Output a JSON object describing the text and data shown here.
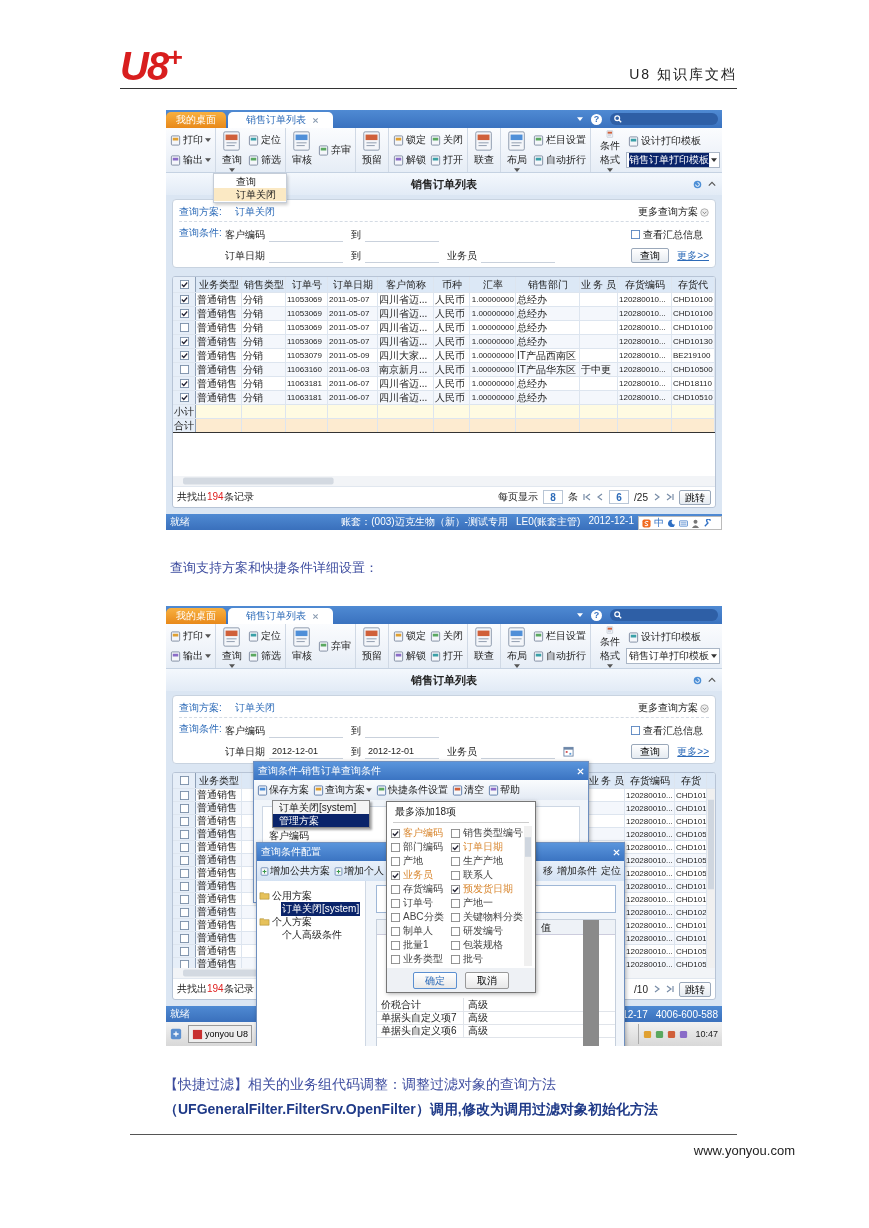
{
  "header": {
    "logo": "U8$^{+}$",
    "doc_title": "U8 知识库文档"
  },
  "screenshots": [
    {
      "tabs": [
        {
          "label": "我的桌面",
          "selected": false,
          "closable": false
        },
        {
          "label": "销售订单列表",
          "selected": true,
          "closable": true
        }
      ],
      "help": "?",
      "toolbar": [
        {
          "columns": [
            {
              "kind": "pair",
              "items": [
                {
                  "kind": "button",
                  "label": "打印",
                  "menu": true
                },
                {
                  "kind": "button",
                  "label": "输出",
                  "menu": true
                }
              ]
            }
          ]
        },
        {
          "columns": [
            {
              "kind": "big",
              "label": "查询",
              "menu": true
            },
            {
              "kind": "pair",
              "items": [
                {
                  "kind": "button",
                  "label": "定位",
                  "menu": false
                },
                {
                  "kind": "button",
                  "label": "筛选",
                  "menu": false
                }
              ]
            }
          ]
        },
        {
          "columns": [
            {
              "kind": "big",
              "label": "审核",
              "menu": false
            },
            {
              "kind": "pair",
              "items": [
                {
                  "kind": "button",
                  "label": "弃审",
                  "menu": false
                }
              ]
            }
          ]
        },
        {
          "columns": [
            {
              "kind": "big",
              "label": "预留",
              "menu": false
            }
          ]
        },
        {
          "columns": [
            {
              "kind": "pair",
              "items": [
                {
                  "kind": "button",
                  "label": "锁定",
                  "menu": false
                },
                {
                  "kind": "button",
                  "label": "解锁",
                  "menu": false
                }
              ]
            },
            {
              "kind": "pair",
              "items": [
                {
                  "kind": "button",
                  "label": "关闭",
                  "menu": false
                },
                {
                  "kind": "button",
                  "label": "打开",
                  "menu": false
                }
              ]
            }
          ]
        },
        {
          "columns": [
            {
              "kind": "big",
              "label": "联查",
              "menu": false
            }
          ]
        },
        {
          "columns": [
            {
              "kind": "big",
              "label": "布局",
              "menu": true
            },
            {
              "kind": "pair",
              "items": [
                {
                  "kind": "button",
                  "label": "栏目设置",
                  "menu": false
                },
                {
                  "kind": "button",
                  "label": "自动折行",
                  "menu": false
                }
              ]
            }
          ]
        },
        {
          "columns": [
            {
              "kind": "big",
              "label": "条件格式",
              "menu": true
            },
            {
              "kind": "pair",
              "items": [
                {
                  "kind": "button",
                  "label": "设计打印模板",
                  "menu": false
                },
                {
                  "kind": "select",
                  "value": "销售订单打印模板",
                  "text_selected": true
                }
              ]
            }
          ]
        }
      ],
      "menu": {
        "items": [
          {
            "label": "查询",
            "selected": false
          },
          {
            "label": "订单关闭",
            "selected": true
          }
        ]
      },
      "title": "销售订单列表",
      "query": {
        "scheme_label": "查询方案:",
        "scheme": "订单关闭",
        "more_schemes": "更多查询方案",
        "condition_label": "查询条件:",
        "rows": [
          [
            {
              "label": "客户编码"
            },
            {
              "label": "到"
            }
          ],
          [
            {
              "label": "订单日期"
            },
            {
              "label": "到"
            },
            {
              "label": "业务员"
            }
          ]
        ],
        "date_picker": false,
        "summary": {
          "label": "查看汇总信息",
          "checked": false
        },
        "button": "查询",
        "more": "更多>>"
      },
      "grid": {
        "header_checked": true,
        "columns": [
          {
            "label": "业务类型",
            "kind": "text"
          },
          {
            "label": "销售类型",
            "kind": "text"
          },
          {
            "label": "订单号",
            "kind": "code"
          },
          {
            "label": "订单日期",
            "kind": "code"
          },
          {
            "label": "客户简称",
            "kind": "text"
          },
          {
            "label": "币种",
            "kind": "text"
          },
          {
            "label": "汇率",
            "kind": "number"
          },
          {
            "label": "销售部门",
            "kind": "text"
          },
          {
            "label": "业 务 员",
            "kind": "text"
          },
          {
            "label": "存货编码",
            "kind": "code"
          },
          {
            "label": "存货代",
            "kind": "code"
          }
        ],
        "rows": [
          {
            "checked": true,
            "cells": [
              "普通销售",
              "分销",
              "11053069",
              "2011-05-07",
              "四川省迈...",
              "人民币",
              "1.00000000",
              "总经办",
              null,
              "120280010...",
              "CHD10100"
            ]
          },
          {
            "checked": true,
            "cells": [
              "普通销售",
              "分销",
              "11053069",
              "2011-05-07",
              "四川省迈...",
              "人民币",
              "1.00000000",
              "总经办",
              null,
              "120280010...",
              "CHD10100"
            ]
          },
          {
            "checked": false,
            "cells": [
              "普通销售",
              "分销",
              "11053069",
              "2011-05-07",
              "四川省迈...",
              "人民币",
              "1.00000000",
              "总经办",
              null,
              "120280010...",
              "CHD10100"
            ]
          },
          {
            "checked": true,
            "cells": [
              "普通销售",
              "分销",
              "11053069",
              "2011-05-07",
              "四川省迈...",
              "人民币",
              "1.00000000",
              "总经办",
              null,
              "120280010...",
              "CHD10130"
            ]
          },
          {
            "checked": true,
            "cells": [
              "普通销售",
              "分销",
              "11053079",
              "2011-05-09",
              "四川大家...",
              "人民币",
              "1.00000000",
              "IT产品西南区",
              null,
              "120280010...",
              "BE219100"
            ]
          },
          {
            "checked": false,
            "cells": [
              "普通销售",
              "分销",
              "11063160",
              "2011-06-03",
              "南京新月...",
              "人民币",
              "1.00000000",
              "IT产品华东区",
              "于中更",
              "120280010...",
              "CHD10500"
            ]
          },
          {
            "checked": true,
            "cells": [
              "普通销售",
              "分销",
              "11063181",
              "2011-06-07",
              "四川省迈...",
              "人民币",
              "1.00000000",
              "总经办",
              null,
              "120280010...",
              "CHD18110"
            ]
          },
          {
            "checked": true,
            "cells": [
              "普通销售",
              "分销",
              "11063181",
              "2011-06-07",
              "四川省迈...",
              "人民币",
              "1.00000000",
              "总经办",
              null,
              "120280010...",
              "CHD10510"
            ]
          }
        ],
        "totals": [
          "小计",
          "合计"
        ],
        "footer": {
          "prefix": "共找出",
          "count": "194",
          "suffix": "条记录"
        },
        "pager": {
          "size_label": "每页显示",
          "size": "8",
          "unit": "条",
          "page": "6",
          "total": "/25",
          "jump": "跳转"
        }
      },
      "status": {
        "left": "就绪",
        "right": [
          "账套：(003)迈克生物（新）-测试专用",
          "LE0(账套主管)",
          "2012-12-1"
        ]
      },
      "ime_bar": {
        "mode": "中"
      }
    },
    {
      "tabs": [
        {
          "label": "我的桌面",
          "selected": false,
          "closable": false
        },
        {
          "label": "销售订单列表",
          "selected": true,
          "closable": true
        }
      ],
      "help": "?",
      "toolbar": [
        {
          "columns": [
            {
              "kind": "pair",
              "items": [
                {
                  "kind": "button",
                  "label": "打印",
                  "menu": true
                },
                {
                  "kind": "button",
                  "label": "输出",
                  "menu": true
                }
              ]
            }
          ]
        },
        {
          "columns": [
            {
              "kind": "big",
              "label": "查询",
              "menu": true
            },
            {
              "kind": "pair",
              "items": [
                {
                  "kind": "button",
                  "label": "定位",
                  "menu": false
                },
                {
                  "kind": "button",
                  "label": "筛选",
                  "menu": false
                }
              ]
            }
          ]
        },
        {
          "columns": [
            {
              "kind": "big",
              "label": "审核",
              "menu": false
            },
            {
              "kind": "pair",
              "items": [
                {
                  "kind": "button",
                  "label": "弃审",
                  "menu": false
                }
              ]
            }
          ]
        },
        {
          "columns": [
            {
              "kind": "big",
              "label": "预留",
              "menu": false
            }
          ]
        },
        {
          "columns": [
            {
              "kind": "pair",
              "items": [
                {
                  "kind": "button",
                  "label": "锁定",
                  "menu": false
                },
                {
                  "kind": "button",
                  "label": "解锁",
                  "menu": false
                }
              ]
            },
            {
              "kind": "pair",
              "items": [
                {
                  "kind": "button",
                  "label": "关闭",
                  "menu": false
                },
                {
                  "kind": "button",
                  "label": "打开",
                  "menu": false
                }
              ]
            }
          ]
        },
        {
          "columns": [
            {
              "kind": "big",
              "label": "联查",
              "menu": false
            }
          ]
        },
        {
          "columns": [
            {
              "kind": "big",
              "label": "布局",
              "menu": true
            },
            {
              "kind": "pair",
              "items": [
                {
                  "kind": "button",
                  "label": "栏目设置",
                  "menu": false
                },
                {
                  "kind": "button",
                  "label": "自动折行",
                  "menu": false
                }
              ]
            }
          ]
        },
        {
          "columns": [
            {
              "kind": "big",
              "label": "条件格式",
              "menu": true
            },
            {
              "kind": "pair",
              "items": [
                {
                  "kind": "button",
                  "label": "设计打印模板",
                  "menu": false
                },
                {
                  "kind": "select",
                  "value": "销售订单打印模板",
                  "text_selected": false
                }
              ]
            }
          ]
        }
      ],
      "title": "销售订单列表",
      "query": {
        "scheme_label": "查询方案:",
        "scheme": "订单关闭",
        "more_schemes": "更多查询方案",
        "condition_label": "查询条件:",
        "rows": [
          [
            {
              "label": "客户编码"
            },
            {
              "label": "到"
            }
          ],
          [
            {
              "label": "订单日期",
              "value": "2012-12-01"
            },
            {
              "label": "到",
              "value": "2012-12-01"
            },
            {
              "label": "业务员"
            }
          ]
        ],
        "date_picker": true,
        "summary": {
          "label": "查看汇总信息",
          "checked": false
        },
        "button": "查询",
        "more": "更多>>"
      },
      "grid": {
        "header_checked": false,
        "columns": [
          {
            "label": "业务类型",
            "kind": "text"
          },
          {
            "label": "业 务 员",
            "kind": "text"
          },
          {
            "label": "存货编码",
            "kind": "code"
          },
          {
            "label": "存货",
            "kind": "code"
          }
        ],
        "rows": [
          {
            "checked": false,
            "cells": [
              "普通销售",
              null,
              "120280010...",
              "CHD101"
            ]
          },
          {
            "checked": false,
            "cells": [
              "普通销售",
              null,
              "120280010...",
              "CHD101"
            ]
          },
          {
            "checked": false,
            "cells": [
              "普通销售",
              null,
              "120280010...",
              "CHD101"
            ]
          },
          {
            "checked": false,
            "cells": [
              "普通销售",
              null,
              "120280010...",
              "CHD105"
            ]
          },
          {
            "checked": false,
            "cells": [
              "普通销售",
              null,
              "120280010...",
              "CHD101"
            ]
          },
          {
            "checked": false,
            "cells": [
              "普通销售",
              null,
              "120280010...",
              "CHD105"
            ]
          },
          {
            "checked": false,
            "cells": [
              "普通销售",
              null,
              "120280010...",
              "CHD105"
            ]
          },
          {
            "checked": false,
            "cells": [
              "普通销售",
              null,
              "120280010...",
              "CHD101"
            ]
          },
          {
            "checked": false,
            "cells": [
              "普通销售",
              null,
              "120280010...",
              "CHD101"
            ]
          },
          {
            "checked": false,
            "cells": [
              "普通销售",
              null,
              "120280010...",
              "CHD102"
            ]
          },
          {
            "checked": false,
            "cells": [
              "普通销售",
              null,
              "120280010...",
              "CHD101"
            ]
          },
          {
            "checked": false,
            "cells": [
              "普通销售",
              null,
              "120280010...",
              "CHD101"
            ]
          },
          {
            "checked": false,
            "cells": [
              "普通销售",
              null,
              "120280010...",
              "CHD105"
            ]
          },
          {
            "checked": false,
            "cells": [
              "普通销售",
              null,
              "120280010...",
              "CHD105"
            ]
          }
        ],
        "footer": {
          "prefix": "共找出",
          "count": "194",
          "suffix": "条记录"
        },
        "pager": {
          "total": "/10",
          "jump": "跳转"
        }
      },
      "status": {
        "left": "就绪",
        "right": [
          "12-17",
          "4006-600-588"
        ]
      },
      "taskbar": {
        "task": "yonyou U8",
        "clock": "10:47"
      },
      "dialogs": {
        "query_dialog": {
          "title": "查询条件-销售订单查询条件",
          "toolbar": [
            {
              "label": "保存方案",
              "menu": false
            },
            {
              "label": "查询方案",
              "menu": true
            },
            {
              "label": "快捷条件设置",
              "menu": false
            },
            {
              "label": "清空",
              "menu": false
            },
            {
              "label": "帮助",
              "menu": false
            }
          ],
          "menu": [
            {
              "label": "订单关闭[system]",
              "selected": false
            },
            {
              "label": "管理方案",
              "selected": true
            }
          ],
          "field": "客户编码"
        },
        "config_dialog": {
          "title": "查询条件配置",
          "toolbar_left": [
            "增加公共方案",
            "增加个人"
          ],
          "toolbar_right": [
            "移",
            "增加条件",
            "定位"
          ],
          "tree": [
            {
              "label": "公用方案",
              "children": [
                {
                  "label": "订单关闭[system]",
                  "selected": true
                }
              ]
            },
            {
              "label": "个人方案",
              "children": [
                {
                  "label": "个人高级条件",
                  "selected": false
                }
              ]
            }
          ],
          "value_header": "值",
          "rows": [
            [
              "价税合计",
              "高级"
            ],
            [
              "单据头自定义项7",
              "高级"
            ],
            [
              "单据头自定义项6",
              "高级"
            ]
          ]
        },
        "field_picker": {
          "title": "最多添加18项",
          "options": [
            {
              "label": "客户编码",
              "checked": true
            },
            {
              "label": "销售类型编号",
              "checked": false
            },
            {
              "label": "部门编码",
              "checked": false
            },
            {
              "label": "订单日期",
              "checked": true
            },
            {
              "label": "产地",
              "checked": false
            },
            {
              "label": "生产产地",
              "checked": false
            },
            {
              "label": "业务员",
              "checked": true
            },
            {
              "label": "联系人",
              "checked": false
            },
            {
              "label": "存货编码",
              "checked": false
            },
            {
              "label": "预发货日期",
              "checked": true
            },
            {
              "label": "订单号",
              "checked": false
            },
            {
              "label": "产地一",
              "checked": false
            },
            {
              "label": "ABC分类",
              "checked": false
            },
            {
              "label": "关键物料分类",
              "checked": false
            },
            {
              "label": "制单人",
              "checked": false
            },
            {
              "label": "研发编号",
              "checked": false
            },
            {
              "label": "批量1",
              "checked": false
            },
            {
              "label": "包装规格",
              "checked": false
            },
            {
              "label": "业务类型",
              "checked": false
            },
            {
              "label": "批号",
              "checked": false
            }
          ],
          "ok": "确定",
          "cancel": "取消"
        }
      }
    }
  ],
  "caption": "查询支持方案和快捷条件详细设置：",
  "paragraph": [
    {
      "text": "【快捷过滤】相关的业务组代码调整：调整过滤对象的查询方法",
      "bold": false
    },
    {
      "text": "（UFGeneralFilter.FilterSrv.OpenFilter）调用,修改为调用过滤对象初始化方法",
      "bold": true
    }
  ],
  "footer": {
    "url": "www.yonyou.com"
  }
}
